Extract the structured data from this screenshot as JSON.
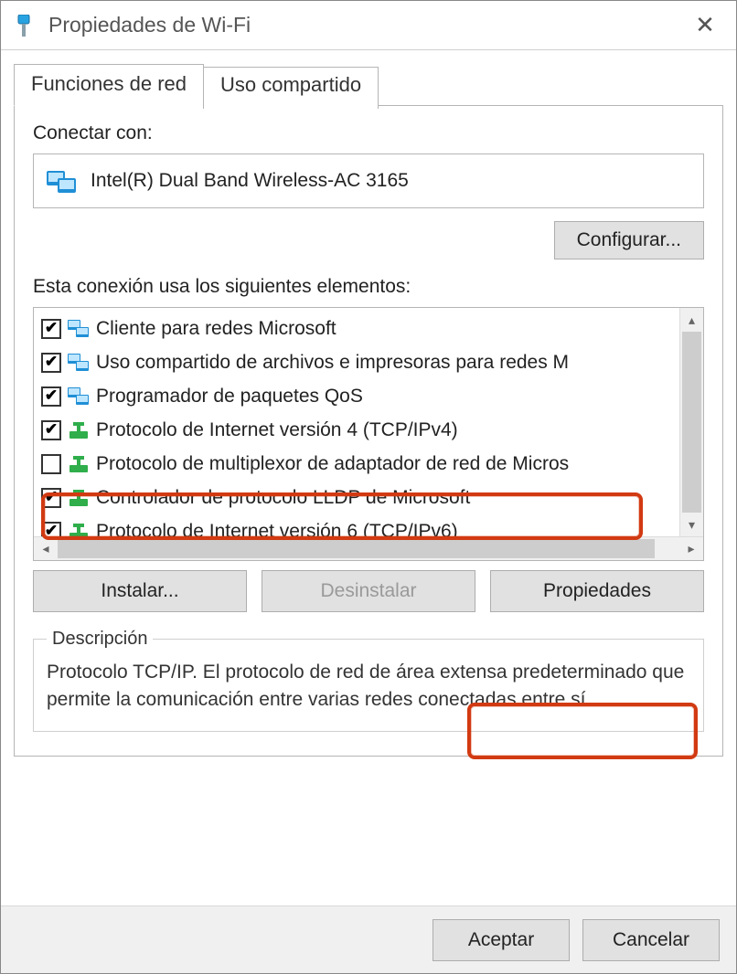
{
  "window": {
    "title": "Propiedades de Wi-Fi"
  },
  "tabs": {
    "networking": "Funciones de red",
    "sharing": "Uso compartido"
  },
  "connect": {
    "label": "Conectar con:",
    "adapter": "Intel(R) Dual Band Wireless-AC 3165",
    "configure": "Configurar..."
  },
  "elements": {
    "label": "Esta conexión usa los siguientes elementos:",
    "items": [
      {
        "checked": true,
        "icon": "client",
        "text": "Cliente para redes Microsoft"
      },
      {
        "checked": true,
        "icon": "share",
        "text": "Uso compartido de archivos e impresoras para redes M"
      },
      {
        "checked": true,
        "icon": "qos",
        "text": "Programador de paquetes QoS"
      },
      {
        "checked": true,
        "icon": "proto",
        "text": "Protocolo de Internet versión 4 (TCP/IPv4)"
      },
      {
        "checked": false,
        "icon": "proto",
        "text": "Protocolo de multiplexor de adaptador de red de Micros"
      },
      {
        "checked": true,
        "icon": "proto",
        "text": "Controlador de protocolo LLDP de Microsoft"
      },
      {
        "checked": true,
        "icon": "proto",
        "text": "Protocolo de Internet versión 6 (TCP/IPv6)"
      }
    ]
  },
  "buttons": {
    "install": "Instalar...",
    "uninstall": "Desinstalar",
    "properties": "Propiedades"
  },
  "description": {
    "legend": "Descripción",
    "text": "Protocolo TCP/IP. El protocolo de red de área extensa predeterminado que permite la comunicación entre varias redes conectadas entre sí."
  },
  "footer": {
    "ok": "Aceptar",
    "cancel": "Cancelar"
  }
}
